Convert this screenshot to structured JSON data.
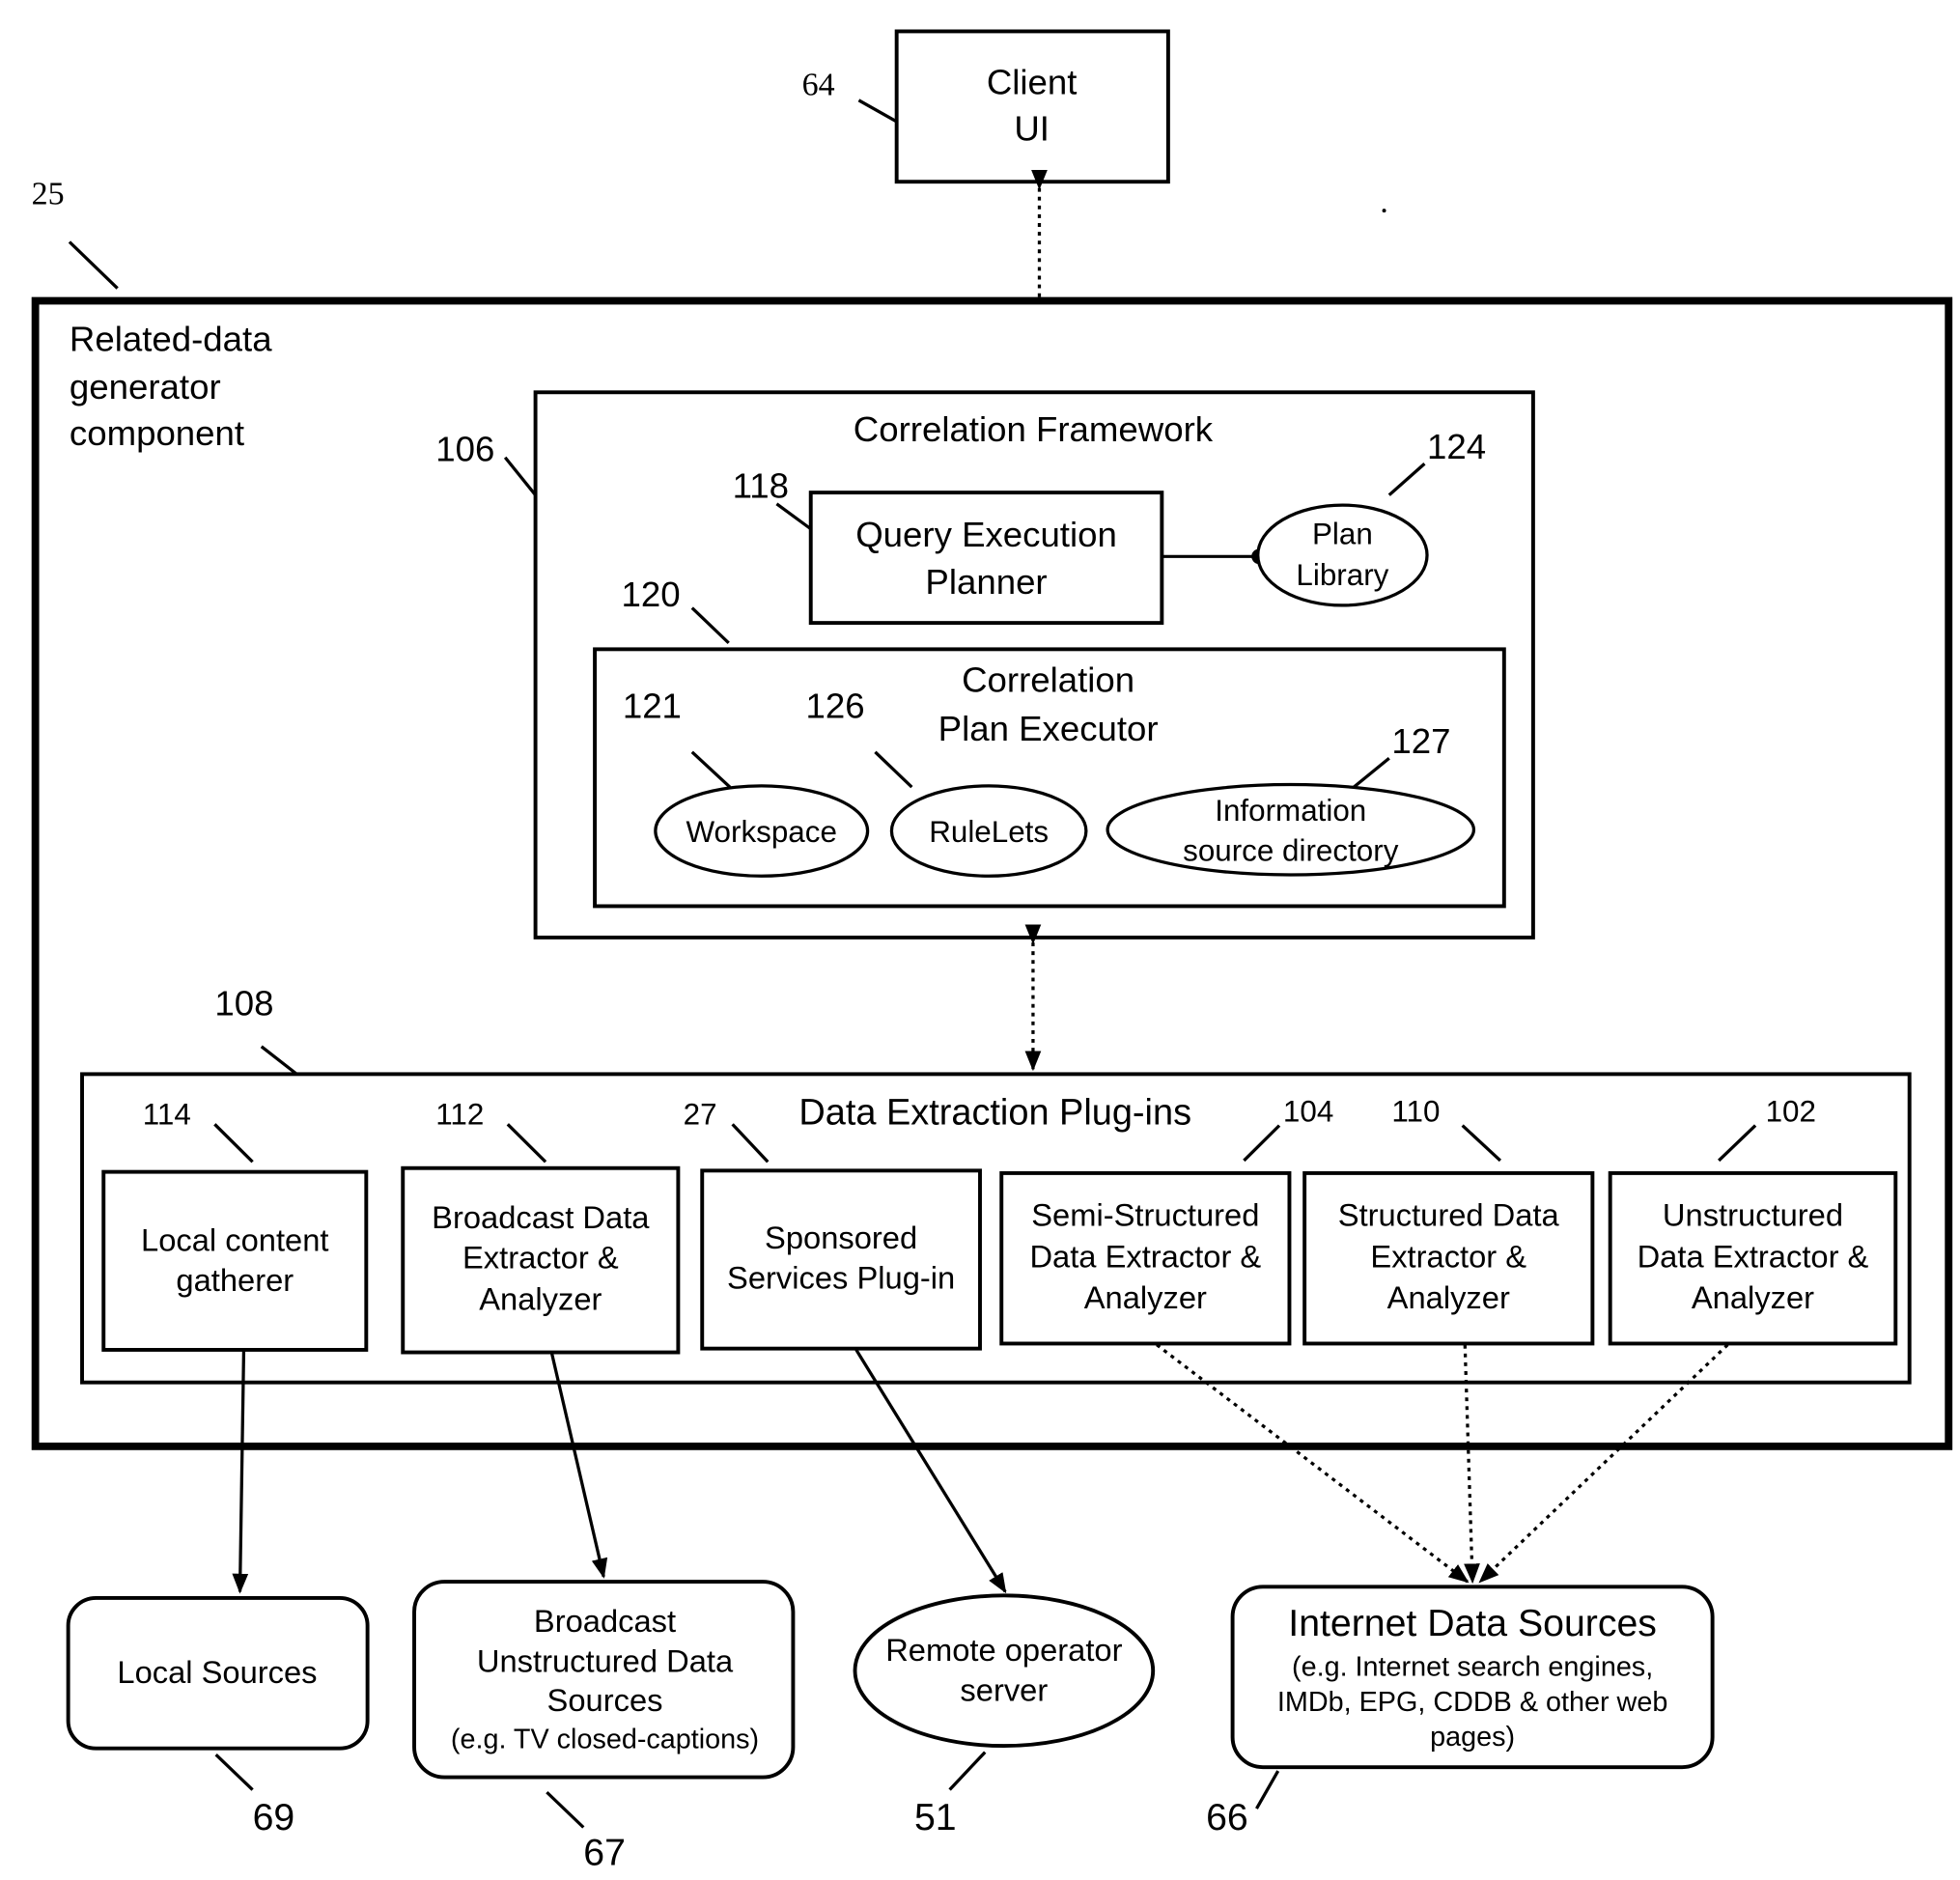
{
  "client_ui": {
    "ref": "64",
    "lines": [
      "Client",
      "UI"
    ]
  },
  "outer": {
    "ref": "25",
    "lines": [
      "Related-data",
      "generator",
      "component"
    ]
  },
  "correlation_framework": {
    "ref": "106",
    "title": "Correlation Framework",
    "query_planner": {
      "ref": "118",
      "lines": [
        "Query Execution",
        "Planner"
      ]
    },
    "plan_library": {
      "ref": "124",
      "lines": [
        "Plan",
        "Library"
      ]
    },
    "plan_executor": {
      "ref": "120",
      "lines": [
        "Correlation",
        "Plan Executor"
      ],
      "workspace": {
        "ref": "121",
        "label": "Workspace"
      },
      "rulelets": {
        "ref": "126",
        "label": "RuleLets"
      },
      "info_dir": {
        "ref": "127",
        "lines": [
          "Information",
          "source directory"
        ]
      }
    }
  },
  "plugins": {
    "ref": "108",
    "title": "Data Extraction Plug-ins",
    "items": [
      {
        "ref": "114",
        "lines": [
          "Local content",
          "gatherer"
        ]
      },
      {
        "ref": "112",
        "lines": [
          "Broadcast Data",
          "Extractor  &",
          "Analyzer"
        ]
      },
      {
        "ref": "27",
        "lines": [
          "Sponsored",
          "Services Plug-in"
        ]
      },
      {
        "ref": "104",
        "lines": [
          "Semi-Structured",
          "Data Extractor &",
          "Analyzer"
        ]
      },
      {
        "ref": "110",
        "lines": [
          "Structured Data",
          "Extractor &",
          "Analyzer"
        ]
      },
      {
        "ref": "102",
        "lines": [
          "Unstructured",
          "Data Extractor &",
          "Analyzer"
        ]
      }
    ]
  },
  "sources": {
    "local": {
      "ref": "69",
      "lines": [
        "Local Sources"
      ]
    },
    "broadcast": {
      "ref": "67",
      "lines": [
        "Broadcast",
        "Unstructured Data",
        "Sources",
        "(e.g. TV closed-captions)"
      ]
    },
    "remote": {
      "ref": "51",
      "lines": [
        "Remote operator",
        "server"
      ]
    },
    "internet": {
      "ref": "66",
      "title": "Internet Data Sources",
      "lines": [
        "(e.g. Internet search engines,",
        "IMDb, EPG, CDDB & other web",
        "pages)"
      ]
    }
  }
}
